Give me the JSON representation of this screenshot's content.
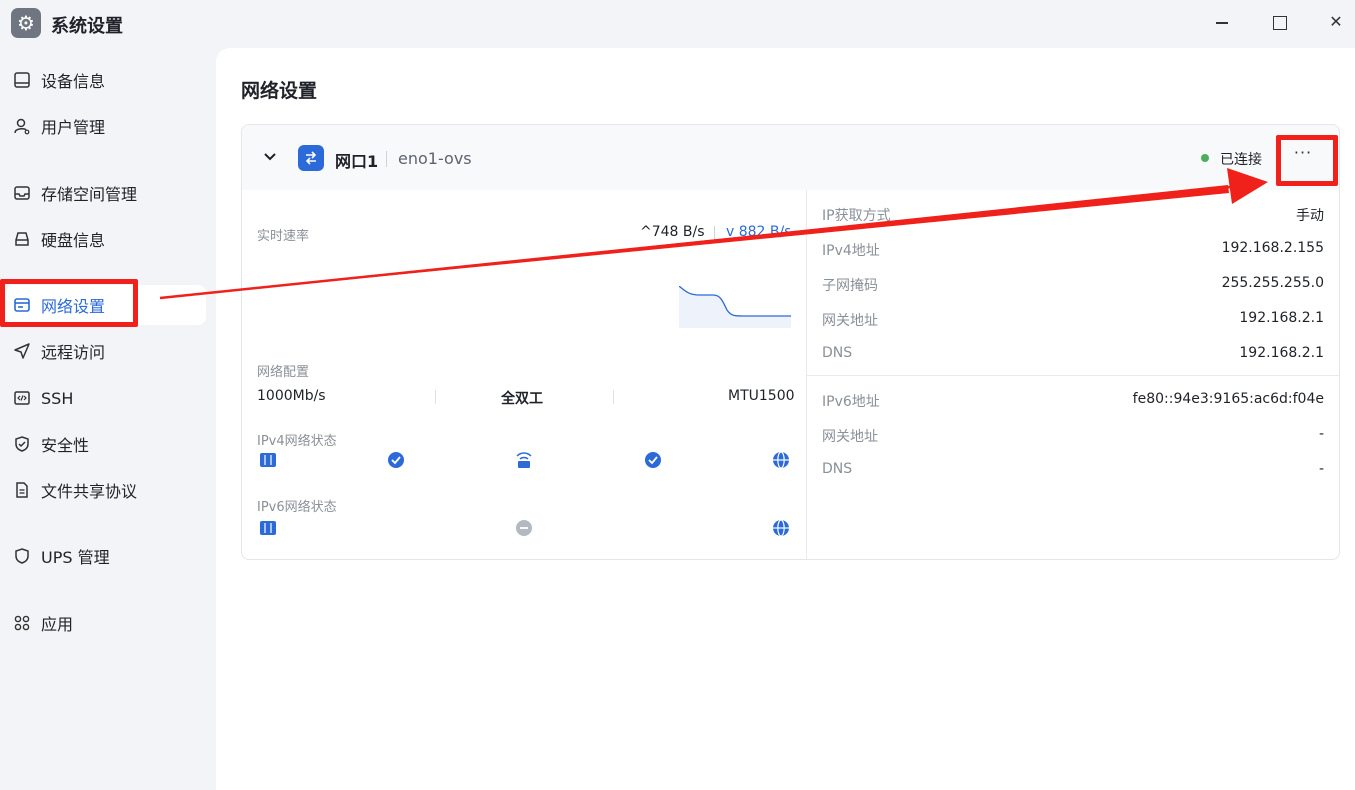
{
  "window": {
    "title": "系统设置"
  },
  "sidebar": {
    "items": [
      {
        "label": "设备信息",
        "icon": "monitor-icon"
      },
      {
        "label": "用户管理",
        "icon": "user-settings-icon"
      },
      {
        "label": "存储空间管理",
        "icon": "inbox-icon"
      },
      {
        "label": "硬盘信息",
        "icon": "hard-drive-icon"
      },
      {
        "label": "网络设置",
        "icon": "browser-window-icon",
        "active": true
      },
      {
        "label": "远程访问",
        "icon": "send-icon"
      },
      {
        "label": "SSH",
        "icon": "code-icon"
      },
      {
        "label": "安全性",
        "icon": "shield-check-icon"
      },
      {
        "label": "文件共享协议",
        "icon": "document-icon"
      },
      {
        "label": "UPS 管理",
        "icon": "shield-icon"
      },
      {
        "label": "应用",
        "icon": "apps-grid-icon"
      }
    ]
  },
  "main": {
    "title": "网络设置",
    "card": {
      "port_name": "网口1",
      "device": "eno1-ovs",
      "status": "已连接",
      "status_color": "#4cae5b",
      "more_label": "···",
      "speed": {
        "label": "实时速率",
        "up": "^748 B/s",
        "down": "v 882 B/s"
      },
      "config": {
        "label": "网络配置",
        "speed": "1000Mb/s",
        "duplex": "全双工",
        "mtu": "MTU1500"
      },
      "ipv4_status_label": "IPv4网络状态",
      "ipv6_status_label": "IPv6网络状态",
      "ipv4_info": [
        {
          "key": "IP获取方式",
          "value": "手动"
        },
        {
          "key": "IPv4地址",
          "value": "192.168.2.155"
        },
        {
          "key": "子网掩码",
          "value": "255.255.255.0"
        },
        {
          "key": "网关地址",
          "value": "192.168.2.1"
        },
        {
          "key": "DNS",
          "value": "192.168.2.1"
        }
      ],
      "ipv6_info": [
        {
          "key": "IPv6地址",
          "value": "fe80::94e3:9165:ac6d:f04e"
        },
        {
          "key": "网关地址",
          "value": "-"
        },
        {
          "key": "DNS",
          "value": "-"
        }
      ]
    }
  },
  "colors": {
    "accent": "#2b6ad8",
    "annotation_red": "#f0201a"
  }
}
